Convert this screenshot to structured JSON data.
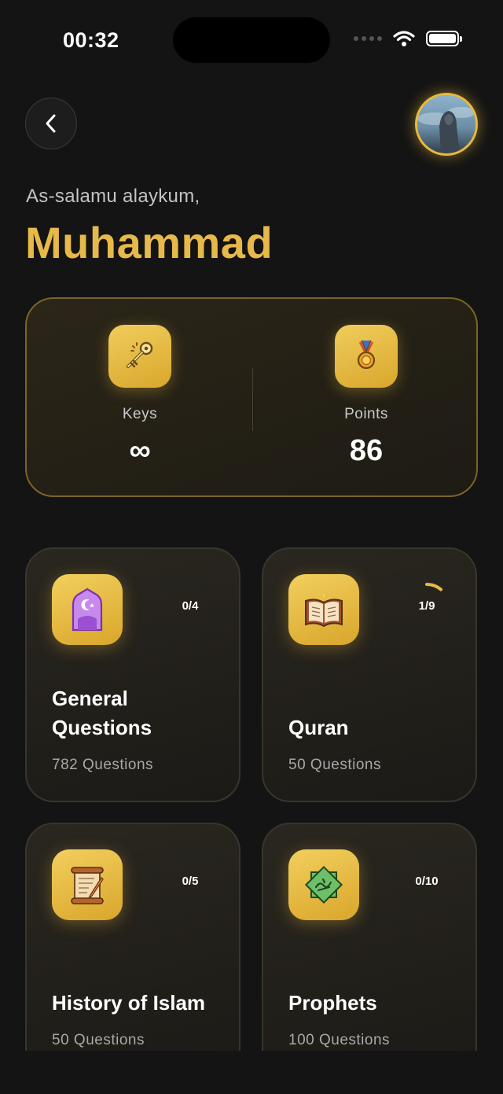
{
  "status_bar": {
    "time": "00:32"
  },
  "header": {
    "greeting": "As-salamu alaykum,",
    "username": "Muhammad"
  },
  "stats": {
    "keys": {
      "label": "Keys",
      "value": "∞",
      "icon": "key-icon"
    },
    "points": {
      "label": "Points",
      "value": "86",
      "icon": "medal-icon"
    }
  },
  "categories": [
    {
      "title": "General Questions",
      "subtitle": "782 Questions",
      "progress_text": "0/4",
      "progress": 0.0,
      "icon": "mosque-icon"
    },
    {
      "title": "Quran",
      "subtitle": "50 Questions",
      "progress_text": "1/9",
      "progress": 0.111,
      "icon": "quran-book-icon"
    },
    {
      "title": "History of Islam",
      "subtitle": "50 Questions",
      "progress_text": "0/5",
      "progress": 0.0,
      "icon": "scroll-icon"
    },
    {
      "title": "Prophets",
      "subtitle": "100 Questions",
      "progress_text": "0/10",
      "progress": 0.0,
      "icon": "calligraphy-star-icon"
    }
  ],
  "colors": {
    "accent": "#e6b94a",
    "background": "#141414",
    "card_border": "#7a6426"
  }
}
